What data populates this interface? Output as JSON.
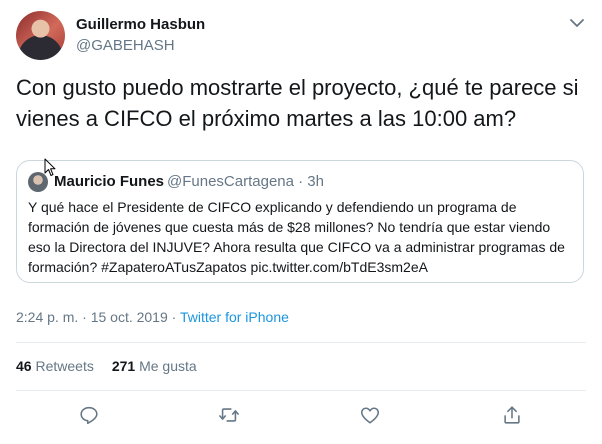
{
  "author": {
    "name": "Guillermo Hasbun",
    "handle": "@GABEHASH"
  },
  "tweet": {
    "text": "Con gusto puedo mostrarte el proyecto, ¿qué te parece si vienes a CIFCO el próximo martes a las 10:00 am?"
  },
  "quoted_tweet": {
    "name": "Mauricio Funes",
    "handle_time": "@FunesCartagena · 3h",
    "text": "Y qué hace el Presidente de CIFCO explicando y defendiendo un programa de formación de jóvenes que cuesta más de $28 millones? No tendría que estar viendo eso la Directora del INJUVE? Ahora resulta que CIFCO va a administrar programas de formación? #ZapateroATusZapatos pic.twitter.com/bTdE3sm2eA"
  },
  "meta": {
    "timestamp": "2:24 p. m. · 15 oct. 2019 · ",
    "source": "Twitter for iPhone"
  },
  "stats": {
    "retweets_count": "46",
    "retweets_label": "Retweets",
    "likes_count": "271",
    "likes_label": "Me gusta"
  },
  "actions": {
    "reply_icon": "reply-icon",
    "retweet_icon": "retweet-icon",
    "like_icon": "heart-icon",
    "share_icon": "share-icon"
  },
  "colors": {
    "link": "#1b95e0",
    "secondary_text": "#657786",
    "border": "#ccd6dd"
  }
}
